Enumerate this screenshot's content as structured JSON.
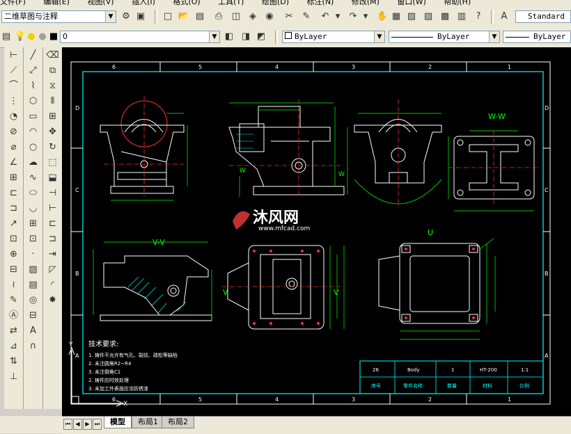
{
  "menu": [
    "文件(F)",
    "编辑(E)",
    "视图(V)",
    "插入(I)",
    "格式(O)",
    "工具(T)",
    "绘图(D)",
    "标注(N)",
    "修改(M)",
    "窗口(W)",
    "帮助(H)"
  ],
  "workspace": {
    "value": "二维草图与注释"
  },
  "text_style": {
    "value": "Standard"
  },
  "layer": {
    "value": "0"
  },
  "color": {
    "value": "ByLayer"
  },
  "linetype": {
    "value": "ByLayer"
  },
  "lineweight": {
    "value": "ByLayer"
  },
  "drawing": {
    "grid_letters": [
      "D",
      "C",
      "B",
      "A"
    ],
    "grid_numbers": [
      "6",
      "5",
      "4",
      "3",
      "2",
      "1"
    ],
    "view_labels": {
      "w_w": "W-W",
      "v_v": "V-V",
      "u": "U",
      "w": "W",
      "v": "V"
    },
    "watermark_text": "沐风网",
    "watermark_url": "www.mfcad.com",
    "tech_req": {
      "title": "技术要求:",
      "lines": [
        "1. 铸件不允许有气孔、裂纹、疏松等缺陷",
        "2. 未注圆角R2~R4",
        "3. 未注倒角C1",
        "2. 铸件应时效处理",
        "3. 未加工外表面应涂防锈漆"
      ]
    },
    "title_block": {
      "row1": [
        "26",
        "Body",
        "1",
        "HT-200",
        "1:1"
      ],
      "row2": [
        "序号",
        "零件名称",
        "数量",
        "材料",
        "比例"
      ]
    },
    "ucs_x": "X",
    "ucs_y": "Y"
  },
  "tabs": [
    "模型",
    "布局1",
    "布局2"
  ],
  "colors": {
    "canvas": "#000000",
    "frame": "#00ffff",
    "geometry": "#ffffff",
    "center": "#ff3030",
    "dims": "#00ff00",
    "hatch": "#00ffff"
  }
}
